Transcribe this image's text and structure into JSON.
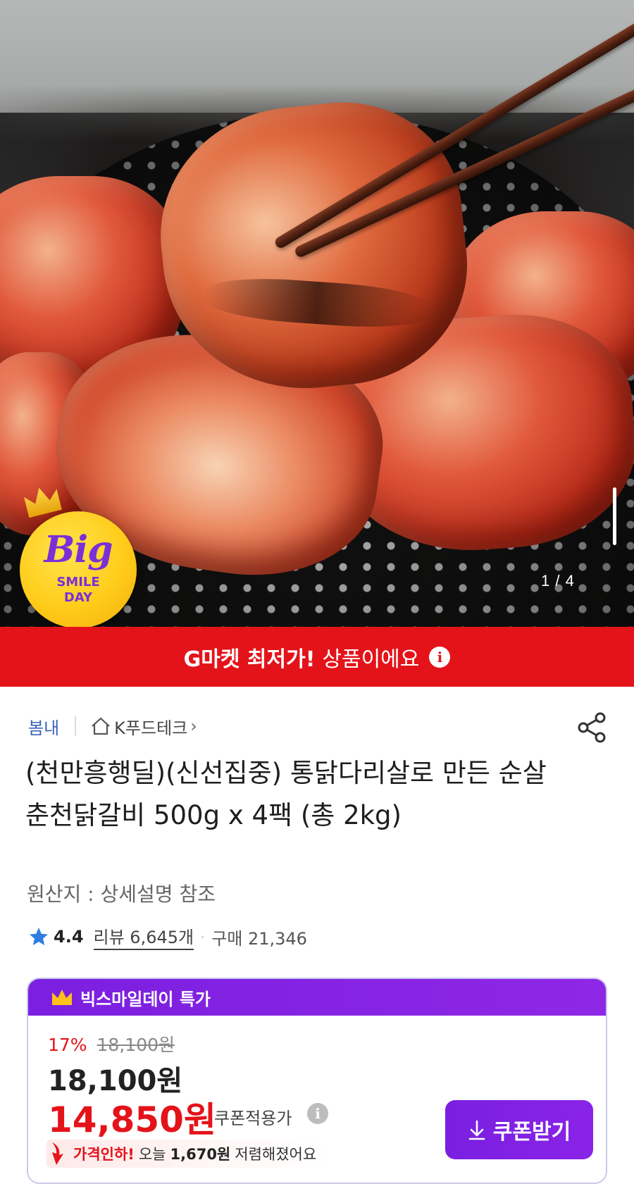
{
  "hero": {
    "image_counter": "1 / 4",
    "badge": {
      "big": "Big",
      "line1": "SMILE",
      "line2": "DAY"
    }
  },
  "banner": {
    "strong": "G마켓 최저가!",
    "text": "상품이에요",
    "icon": "info-icon"
  },
  "seller": {
    "brand": "봄내",
    "store": "K푸드테크",
    "chevron": "›"
  },
  "product": {
    "title": "(천만흥행딜)(신선집중) 통닭다리살로 만든 순살 춘천닭갈비 500g x 4팩 (총 2kg)",
    "origin": "원산지 : 상세설명 참조"
  },
  "rating": {
    "score": "4.4",
    "review_text": "리뷰 6,645개",
    "separator": "·",
    "purchase_text": "구매 21,346"
  },
  "price_card": {
    "header": "빅스마일데이 특가",
    "discount_pct": "17%",
    "original_price": "18,100원",
    "price": "18,100원",
    "coupon_price": "14,850원",
    "coupon_label": "쿠폰적용가",
    "price_drop": {
      "lead": "가격인하!",
      "text_before": "오늘",
      "amount": "1,670원",
      "text_after": "저렴해졌어요"
    },
    "coupon_button": "쿠폰받기"
  },
  "colors": {
    "accent_red": "#e4131a",
    "accent_purple": "#7b1fe0",
    "link_blue": "#3a64b7"
  },
  "icons": [
    "home-icon",
    "share-icon",
    "star-icon",
    "crown-icon",
    "info-icon",
    "download-icon",
    "down-arrow-icon"
  ]
}
